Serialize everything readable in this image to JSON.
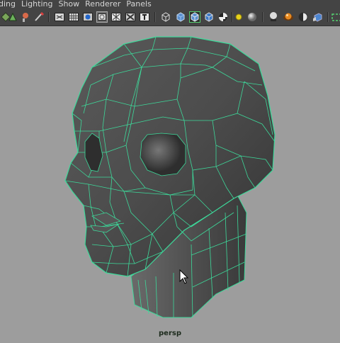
{
  "menubar": {
    "items": [
      "ding",
      "Lighting",
      "Show",
      "Renderer",
      "Panels"
    ]
  },
  "toolbar": {
    "icons": [
      "move-tool-icon",
      "select-tool-icon",
      "paint-tool-icon",
      "lasso-tool-icon",
      "grid-icon",
      "film-gate-icon",
      "isolate-icon",
      "wireframe-icon",
      "xray-icon",
      "text-icon",
      "wireframe-cube-icon",
      "smooth-shade-cube-icon",
      "wireframe-on-shaded-icon",
      "checker-icon",
      "light-icon",
      "sphere-icon",
      "studio-light-icon",
      "ambient-occlusion-icon",
      "half-shade-icon",
      "cube-icon",
      "camera-icon"
    ]
  },
  "viewport": {
    "camera": "persp",
    "background_color": "#9d9d9d",
    "wireframe_color": "#3dd99a",
    "mesh_color": "#4a4a4a"
  }
}
